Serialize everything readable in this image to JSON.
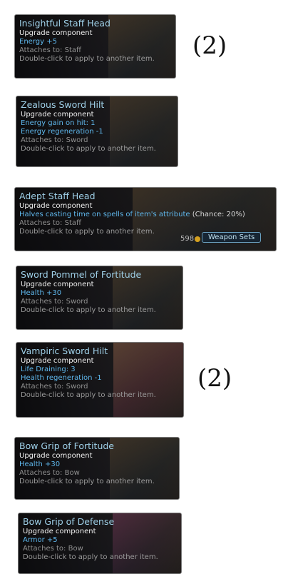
{
  "items": [
    {
      "title": "Insightful Staff Head",
      "subtitle": "Upgrade component",
      "stats": [
        "Energy +5"
      ],
      "attaches": "Attaches to: Staff",
      "action": "Double-click to apply to another item."
    },
    {
      "title": "Zealous Sword Hilt",
      "subtitle": "Upgrade component",
      "stats": [
        "Energy gain on hit: 1",
        "Energy regeneration -1"
      ],
      "attaches": "Attaches to: Sword",
      "action": "Double-click to apply to another item."
    },
    {
      "title": "Adept Staff Head",
      "subtitle": "Upgrade component",
      "stats": [
        "Halves casting time on spells of item's attribute"
      ],
      "chance": "(Chance: 20%)",
      "attaches": "Attaches to: Staff",
      "action": "Double-click to apply to another item.",
      "button": "Weapon Sets",
      "gold": "598"
    },
    {
      "title": "Sword Pommel of Fortitude",
      "subtitle": "Upgrade component",
      "stats": [
        "Health +30"
      ],
      "attaches": "Attaches to: Sword",
      "action": "Double-click to apply to another item."
    },
    {
      "title": "Vampiric Sword Hilt",
      "subtitle": "Upgrade component",
      "stats": [
        "Life Draining: 3",
        "Health regeneration -1"
      ],
      "attaches": "Attaches to: Sword",
      "action": "Double-click to apply to another item."
    },
    {
      "title": "Bow Grip of Fortitude",
      "subtitle": "Upgrade component",
      "stats": [
        "Health +30"
      ],
      "attaches": "Attaches to: Bow",
      "action": "Double-click to apply to another item."
    },
    {
      "title": "Bow Grip of Defense",
      "subtitle": "Upgrade component",
      "stats": [
        "Armor +5"
      ],
      "attaches": "Attaches to: Bow",
      "action": "Double-click to apply to another item."
    }
  ],
  "counts": {
    "first": "(2)",
    "fifth": "(2)"
  }
}
